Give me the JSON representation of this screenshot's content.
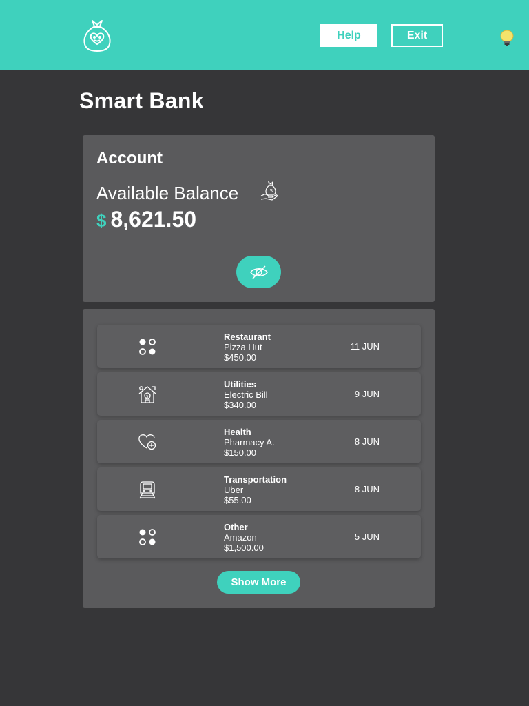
{
  "header": {
    "help_label": "Help",
    "exit_label": "Exit",
    "accent_color": "#3fd1bd",
    "logo_icon": "money-bag-heart-icon",
    "theme_icon": "lightbulb-icon"
  },
  "page": {
    "title": "Smart Bank"
  },
  "account": {
    "title": "Account",
    "balance_label": "Available Balance",
    "balance_icon": "money-bag-hand-icon",
    "currency_symbol": "$",
    "balance": "8,621.50",
    "toggle_icon": "eye-slash-icon"
  },
  "transactions": [
    {
      "category": "Restaurant",
      "merchant": "Pizza Hut",
      "amount": "$450.00",
      "date": "11 JUN",
      "icon": "dots-grid-icon"
    },
    {
      "category": "Utilities",
      "merchant": "Electric Bill",
      "amount": "$340.00",
      "date": "9 JUN",
      "icon": "house-dollar-icon"
    },
    {
      "category": "Health",
      "merchant": "Pharmacy A.",
      "amount": "$150.00",
      "date": "8 JUN",
      "icon": "heart-plus-icon"
    },
    {
      "category": "Transportation",
      "merchant": "Uber",
      "amount": "$55.00",
      "date": "8 JUN",
      "icon": "train-icon"
    },
    {
      "category": "Other",
      "merchant": "Amazon",
      "amount": "$1,500.00",
      "date": "5 JUN",
      "icon": "dots-grid-icon"
    }
  ],
  "show_more_label": "Show More"
}
